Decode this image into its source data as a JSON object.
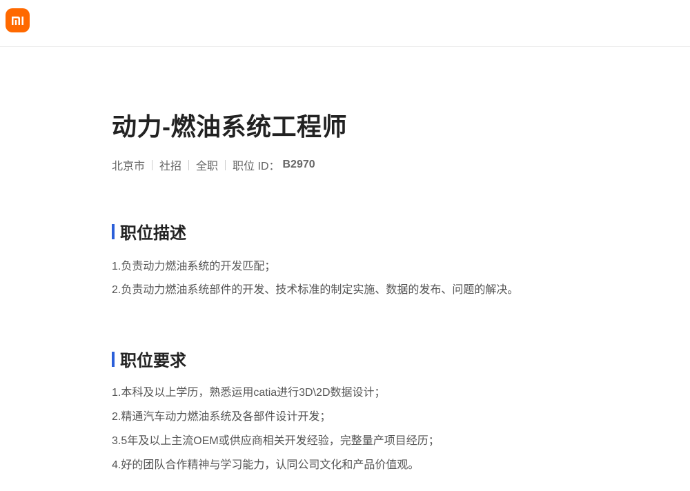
{
  "header": {
    "logo_text": "mi",
    "brand_color": "#ff6900"
  },
  "job": {
    "title": "动力-燃油系统工程师",
    "location": "北京市",
    "recruit_type": "社招",
    "employment": "全职",
    "id_label": "职位 ID：",
    "id_value": "B2970"
  },
  "description": {
    "heading": "职位描述",
    "items": [
      "1.负责动力燃油系统的开发匹配；",
      "2.负责动力燃油系统部件的开发、技术标准的制定实施、数据的发布、问题的解决。"
    ]
  },
  "requirements": {
    "heading": "职位要求",
    "items": [
      "1.本科及以上学历，熟悉运用catia进行3D\\2D数据设计；",
      "2.精通汽车动力燃油系统及各部件设计开发；",
      "3.5年及以上主流OEM或供应商相关开发经验，完整量产项目经历；",
      "4.好的团队合作精神与学习能力，认同公司文化和产品价值观。"
    ]
  },
  "colors": {
    "accent_bar": "#2b5fd9"
  }
}
